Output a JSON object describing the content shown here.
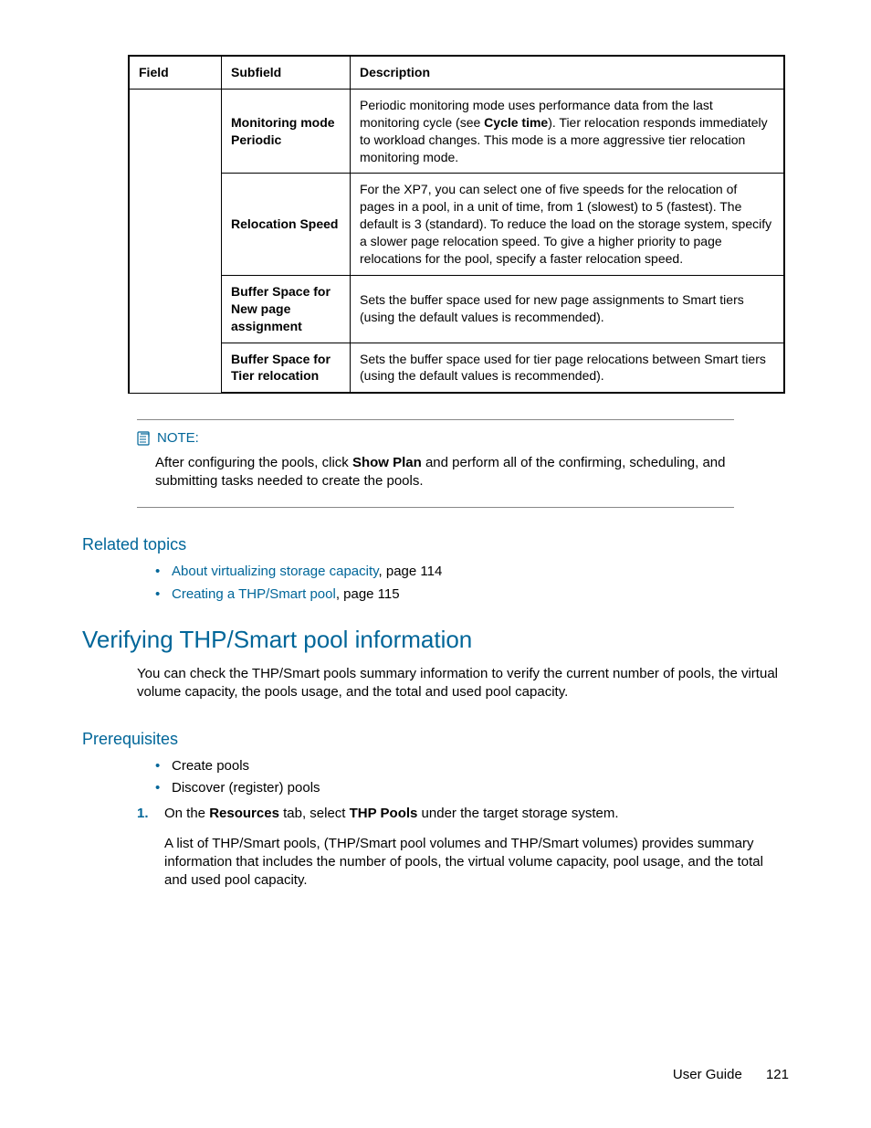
{
  "table": {
    "headers": {
      "field": "Field",
      "subfield": "Subfield",
      "description": "Description"
    },
    "rows": [
      {
        "subfield_line1": "Monitoring mode",
        "subfield_line2": "Periodic",
        "desc_pre": "Periodic monitoring mode uses performance data from the last monitoring cycle (see ",
        "desc_bold": "Cycle time",
        "desc_post": "). Tier relocation responds immediately to workload changes. This mode is a more aggressive tier relocation monitoring mode."
      },
      {
        "subfield": "Relocation Speed",
        "desc": "For the XP7, you can select one of five speeds for the relocation of pages in a pool, in a unit of time, from 1 (slowest) to 5 (fastest). The default is 3 (standard). To reduce the load on the storage system, specify a slower page relocation speed. To give a higher priority to page relocations for the pool, specify a faster relocation speed."
      },
      {
        "subfield": "Buffer Space for New page assignment",
        "desc": "Sets the buffer space used for new page assignments to Smart tiers (using the default values is recommended)."
      },
      {
        "subfield": "Buffer Space for Tier relocation",
        "desc": "Sets the buffer space used for tier page relocations between Smart tiers (using the default values is recommended)."
      }
    ]
  },
  "note": {
    "label": "NOTE:",
    "text_pre": "After configuring the pools, click ",
    "text_bold": "Show Plan",
    "text_post": " and perform all of the confirming, scheduling, and submitting tasks needed to create the pools."
  },
  "related": {
    "heading": "Related topics",
    "items": [
      {
        "link": "About virtualizing storage capacity",
        "suffix": ", page 114"
      },
      {
        "link": "Creating a THP/Smart pool",
        "suffix": ", page 115"
      }
    ]
  },
  "section2": {
    "heading": "Verifying THP/Smart pool information",
    "intro": "You can check the THP/Smart pools summary information to verify the current number of pools, the virtual volume capacity, the pools usage, and the total and used pool capacity."
  },
  "prereq": {
    "heading": "Prerequisites",
    "items": [
      "Create pools",
      "Discover (register) pools"
    ]
  },
  "steps": [
    {
      "num": "1.",
      "pre": "On the ",
      "b1": "Resources",
      "mid": " tab, select ",
      "b2": "THP Pools",
      "post": " under the target storage system.",
      "para": "A list of THP/Smart pools, (THP/Smart pool volumes and THP/Smart volumes) provides summary information that includes the number of pools, the virtual volume capacity, pool usage, and the total and used pool capacity."
    }
  ],
  "footer": {
    "label": "User Guide",
    "page": "121"
  }
}
